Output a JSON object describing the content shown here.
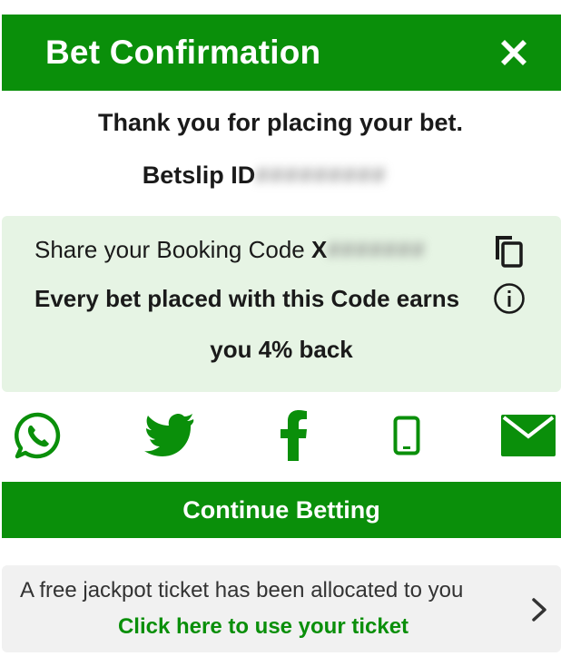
{
  "header": {
    "title": "Bet Confirmation",
    "close_icon": "close-icon"
  },
  "message": {
    "thanks": "Thank you for placing your bet."
  },
  "betslip": {
    "label": "Betslip ID",
    "value_redacted": "#########"
  },
  "share": {
    "label": "Share your Booking Code",
    "code_prefix": "X",
    "code_redacted": "#######",
    "copy_icon": "copy-icon",
    "earn_line1": "Every bet placed with this Code earns",
    "earn_line2": "you 4% back",
    "info_icon": "info-icon"
  },
  "social": {
    "icons": [
      "whatsapp-icon",
      "twitter-icon",
      "facebook-icon",
      "phone-icon",
      "email-icon"
    ]
  },
  "actions": {
    "continue_label": "Continue Betting"
  },
  "jackpot": {
    "text": "A free jackpot ticket has been allocated to you",
    "link_label": "Click here to use your ticket",
    "chevron_icon": "chevron-right-icon"
  },
  "colors": {
    "brand_green": "#0a8f0a",
    "share_bg": "#e6f4e4",
    "jackpot_bg": "#f1f1f1"
  }
}
